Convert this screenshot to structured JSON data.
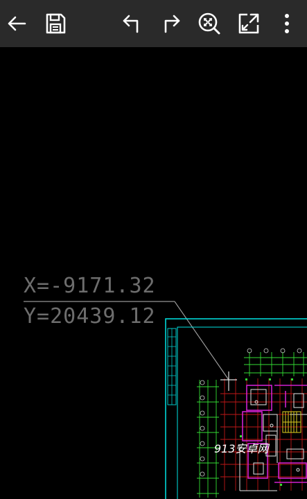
{
  "toolbar": {
    "buttons": [
      {
        "name": "back",
        "icon": "arrow-left-icon"
      },
      {
        "name": "save",
        "icon": "floppy-disk-icon"
      },
      {
        "name": "undo",
        "icon": "undo-arrow-icon"
      },
      {
        "name": "redo",
        "icon": "redo-arrow-icon"
      },
      {
        "name": "zoom-fit",
        "icon": "magnifier-fit-icon"
      },
      {
        "name": "fullscreen",
        "icon": "expand-icon"
      },
      {
        "name": "more",
        "icon": "more-vertical-icon"
      }
    ]
  },
  "canvas": {
    "coord_x": "X=-9171.32",
    "coord_y": "Y=20439.12",
    "watermark": "913安卓网"
  },
  "colors": {
    "toolbar_bg": "#2a2a2a",
    "canvas_bg": "#000000",
    "cad_cyan": "#00e5e5",
    "cad_green": "#33dd33",
    "cad_magenta": "#d020d0",
    "cad_red": "#c01818",
    "cad_yellow": "#e0d020",
    "crosshair": "#cfcfcf"
  }
}
